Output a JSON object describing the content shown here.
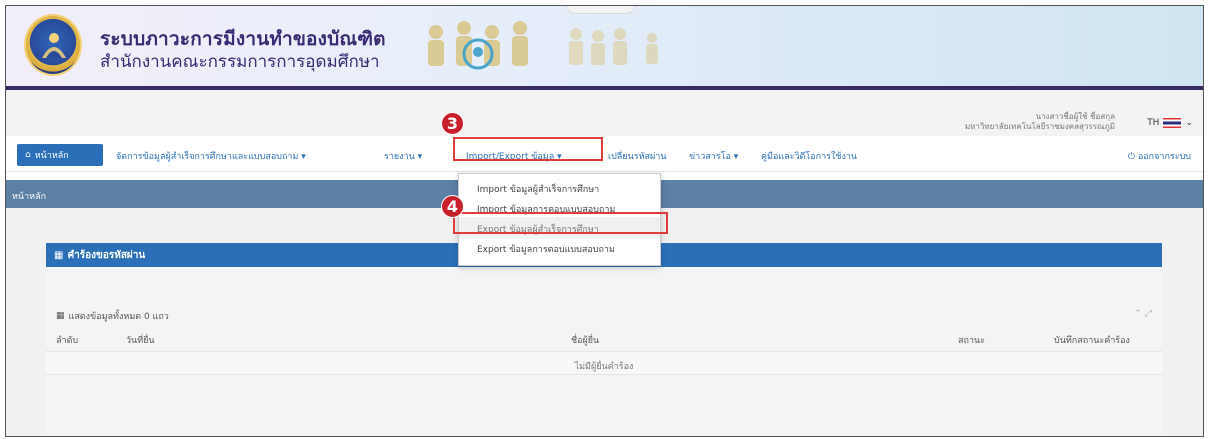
{
  "header": {
    "title": "ระบบภาวะการมีงานทำของบัณฑิต",
    "subtitle": "สำนักงานคณะกรรมการการอุดมศึกษา"
  },
  "userbar": {
    "line1": "นางสาวชื่อผู้ใช้ ชื่อสกุล",
    "line2": "มหาวิทยาลัยเทคโนโลยีราชมงคลสุวรรณภูมิ",
    "lang": "TH"
  },
  "nav": {
    "home": "หน้าหลัก",
    "manage": "จัดการข้อมูลผู้สำเร็จการศึกษาและแบบสอบถาม",
    "report": "รายงาน",
    "import_export": "Import/Export ข้อมูล",
    "change_password": "เปลี่ยนรหัสผ่าน",
    "news": "ข่าวสารโอ",
    "manual": "คู่มือและวิดีโอการใช้งาน",
    "logout": "ออกจากระบบ"
  },
  "breadcrumb": "หน้าหลัก",
  "dropdown": {
    "items": [
      "Import ข้อมูลผู้สำเร็จการศึกษา",
      "Import ข้อมูลการตอบแบบสอบถาม",
      "Export ข้อมูลผู้สำเร็จการศึกษา",
      "Export ข้อมูลการตอบแบบสอบถาม"
    ]
  },
  "panel": {
    "title": "คำร้องขอรหัสผ่าน",
    "count_text": "แสดงข้อมูลทั้งหมด 0 แถว",
    "columns": [
      "ลำดับ",
      "วันที่ยื่น",
      "ชื่อผู้ยื่น",
      "สถานะ",
      "บันทึกสถานะคำร้อง"
    ],
    "empty_text": "ไม่มีผู้ยื่นคำร้อง"
  },
  "steps": {
    "three": "3",
    "four": "4"
  },
  "colors": {
    "nav_blue": "#2b6fb8",
    "highlight_red": "#e03c3c",
    "badge_red": "#c8202a",
    "breadcrumb_bar": "#5c7fa4"
  }
}
